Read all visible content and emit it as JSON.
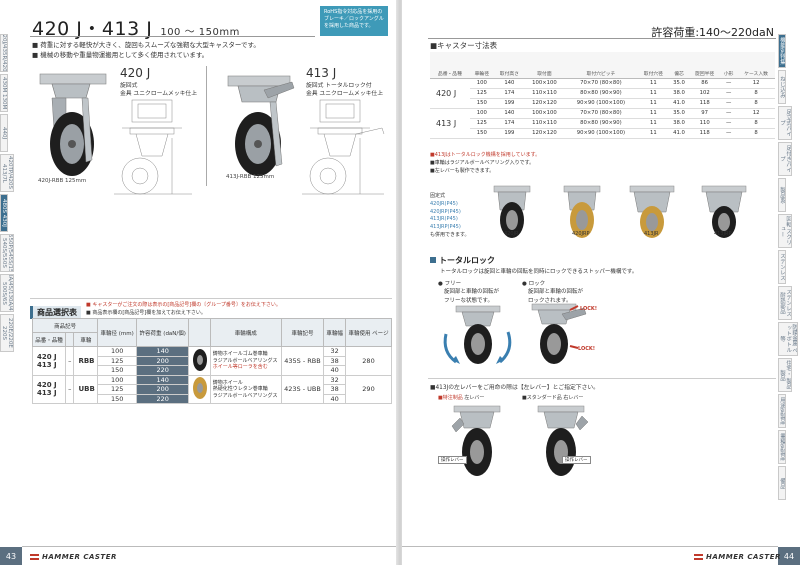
{
  "left": {
    "title": "420 J・413 J",
    "size_range": "100 ～ 150mm",
    "rohs_text": "RoHS指令対応品を採用のブレーキ／ロックアングルを採用した商品です。",
    "intro": [
      "■ 荷重に対する軽快が大きく、旋回もスムーズな強靭な大型キャスターです。",
      "■ 機械の移動や重量物運搬用として多く使用されています。"
    ],
    "products": [
      {
        "name": "420 J",
        "desc1": "旋回式",
        "desc2": "金具 ユニクロームメッキ仕上",
        "caption": "420J-RBB 125mm"
      },
      {
        "name": "413 J",
        "desc1": "旋回式 トータルロック付",
        "desc2": "金具 ユニクロームメッキ仕上",
        "caption": "413J-RBB 125mm"
      }
    ],
    "selection": {
      "title": "商品選択表",
      "notes": [
        "■ キャスターがご注文の際は表示の[商品記号]欄の〔グループ番号〕をお伝え下さい。",
        "■ 商品表示欄の[商品記号]欄を加えてお伝え下さい。"
      ],
      "headers": {
        "group": "商品記号",
        "model_series": "品番・品種",
        "wheel": "車輪",
        "dia": "車輪径 (mm)",
        "load": "許容荷重 (daN/個)",
        "structure": "車輪構成",
        "code": "車輪記号",
        "thickness": "車輪幅",
        "page": "車輪使用 ページ"
      },
      "groups": [
        {
          "model": "420 J\n413 J",
          "model_a": "420 J",
          "model_b": "413 J",
          "wheel": "RBB",
          "rows": [
            {
              "dia": "100",
              "load": "140",
              "width": "32"
            },
            {
              "dia": "125",
              "load": "200",
              "width": "38"
            },
            {
              "dia": "150",
              "load": "220",
              "width": "40"
            }
          ],
          "feature1": "鋳物ホイールゴム巻車輪",
          "feature2": "ラジアルボールベアリングス",
          "feature3": "ホイール等ローラを含む",
          "code": "435S - RBB",
          "page": "280"
        },
        {
          "model": "420 J\n413 J",
          "model_a": "420 J",
          "model_b": "413 J",
          "wheel": "UBB",
          "rows": [
            {
              "dia": "100",
              "load": "140",
              "width": "32"
            },
            {
              "dia": "125",
              "load": "200",
              "width": "38"
            },
            {
              "dia": "150",
              "load": "220",
              "width": "40"
            }
          ],
          "feature1": "鋳物ホイール",
          "feature2": "熱硬化性ウレタン巻車輪",
          "feature3": "ラジアルボールベアリングス",
          "code": "423S - UBB",
          "page": "290"
        }
      ]
    },
    "page_number": "43",
    "brand": "HAMMER CASTER",
    "tabs": [
      "420J/435R/420E",
      "430M 130M",
      "440J",
      "420TP/420S 413/7L",
      "480S 430J",
      "550P/545S/15 540S/550S",
      "130A/45/130A/45S/ 500S/6S",
      "220E/220E 220S"
    ]
  },
  "right": {
    "load": "許容荷重:140～220daN",
    "dim_title": "■キャスター寸法表",
    "dim_headers": [
      "品番・品種",
      "車輪径",
      "取付高さ",
      "取付面",
      "取付穴ピッチ",
      "取付穴径",
      "偏芯",
      "旋回半径",
      "小形",
      "ケース入数"
    ],
    "dim_groups": [
      {
        "model": "420 J",
        "rows": [
          [
            "100",
            "140",
            "100×100",
            "70×70 (80×80)",
            "11",
            "35.0",
            "86",
            "—",
            "12"
          ],
          [
            "125",
            "174",
            "110×110",
            "80×80 (90×90)",
            "11",
            "38.0",
            "102",
            "—",
            "8"
          ],
          [
            "150",
            "199",
            "120×120",
            "90×90 (100×100)",
            "11",
            "41.0",
            "118",
            "—",
            "8"
          ]
        ]
      },
      {
        "model": "413 J",
        "rows": [
          [
            "100",
            "140",
            "100×100",
            "70×70 (80×80)",
            "11",
            "35.0",
            "97",
            "—",
            "12"
          ],
          [
            "125",
            "174",
            "110×110",
            "80×80 (90×90)",
            "11",
            "38.0",
            "110",
            "—",
            "8"
          ],
          [
            "150",
            "199",
            "120×120",
            "90×90 (100×100)",
            "11",
            "41.0",
            "118",
            "—",
            "8"
          ]
        ]
      }
    ],
    "dim_notes": [
      "■413Jはトータルロック機構を採用しています。",
      "■車輪はラジアルボールベアリング入りです。",
      "■左レバーも製作できます。"
    ],
    "fixed": {
      "title": "固定式",
      "items": [
        "420JR(P45)",
        "420JRP(P45)",
        "413JR(P45)",
        "413JRP(P45)"
      ],
      "suffix": "も併用できます。"
    },
    "photos": [
      "420JR",
      "420JRP",
      "413JR",
      "413JRP"
    ],
    "total_lock": {
      "title": "トータルロック",
      "desc": "トータルロックは旋回と車輪の回転を同時にロックできるストッパー機構です。",
      "free_title": "フリー",
      "free_desc1": "旋回部と車輪の回転が",
      "free_desc2": "フリーな状態です。",
      "lock_title": "ロック",
      "lock_desc1": "旋回部と車輪の回転が",
      "lock_desc2": "ロックされます。",
      "lock_label": "LOCK!"
    },
    "lever": {
      "title": "■413Jの左レバーをご用命の際は【左レバー】とご指定下さい。",
      "left_caption_red": "■特注制品",
      "left_caption": "左レバー",
      "right_caption": "■スタンダード品 右レバー",
      "left_tag": "操作レバー",
      "right_tag": "操作レバー"
    },
    "page_number": "44",
    "brand": "HAMMER CASTER",
    "tabs": [
      "機能別特集",
      "ねじ込み",
      "足立式パイプ",
      "足付きパイプ",
      "製品系",
      "回転 スクリュー",
      "ステンレス",
      "ステンレス 耐熱部品",
      "防錆金属 ペットボトル等",
      "住宅・ 製品製品",
      "用途別製品",
      "業種別製品",
      "備品"
    ]
  }
}
